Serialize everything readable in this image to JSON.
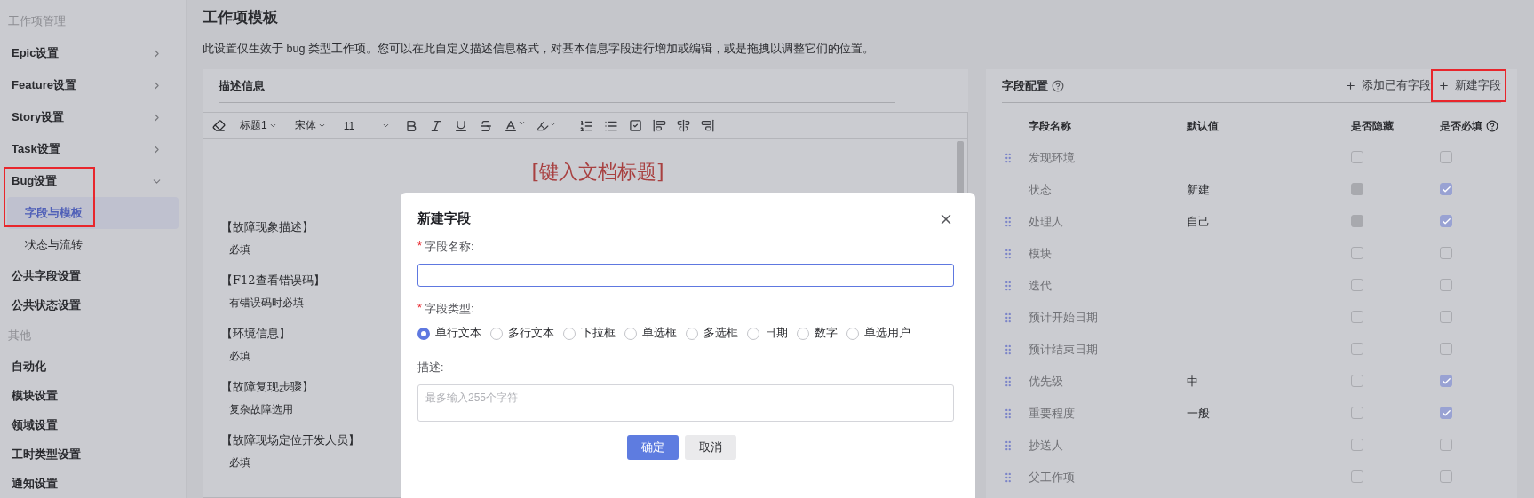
{
  "sidebar": {
    "items": [
      {
        "kind": "heading",
        "label": "工作项管理"
      },
      {
        "kind": "group",
        "label": "Epic设置",
        "expanded": false,
        "highlighted": false
      },
      {
        "kind": "group",
        "label": "Feature设置",
        "expanded": false,
        "highlighted": false
      },
      {
        "kind": "group",
        "label": "Story设置",
        "expanded": false,
        "highlighted": false
      },
      {
        "kind": "group",
        "label": "Task设置",
        "expanded": false,
        "highlighted": false
      },
      {
        "kind": "group",
        "label": "Bug设置",
        "expanded": true,
        "highlighted": true,
        "children": [
          {
            "label": "字段与模板",
            "selected": true
          },
          {
            "label": "状态与流转",
            "selected": false
          }
        ]
      },
      {
        "kind": "item",
        "label": "公共字段设置"
      },
      {
        "kind": "item",
        "label": "公共状态设置"
      },
      {
        "kind": "heading",
        "label": "其他"
      },
      {
        "kind": "item",
        "label": "自动化"
      },
      {
        "kind": "item",
        "label": "模块设置"
      },
      {
        "kind": "item",
        "label": "领域设置"
      },
      {
        "kind": "item",
        "label": "工时类型设置"
      },
      {
        "kind": "item",
        "label": "通知设置"
      }
    ]
  },
  "page": {
    "title": "工作项模板",
    "description": "此设置仅生效于 bug 类型工作项。您可以在此自定义描述信息格式，对基本信息字段进行增加或编辑，或是拖拽以调整它们的位置。"
  },
  "editor": {
    "section_title": "描述信息",
    "toolbar": {
      "heading": "标题1",
      "font": "宋体",
      "size": "11"
    },
    "doc_title": "[键入文档标题]",
    "blocks": [
      {
        "heading": "【故障现象描述】",
        "note": "必填"
      },
      {
        "heading": "【F12查看错误码】",
        "note": "有错误码时必填"
      },
      {
        "heading": "【环境信息】",
        "note": "必填"
      },
      {
        "heading": "【故障复现步骤】",
        "note": "复杂故障选用"
      },
      {
        "heading": "【故障现场定位开发人员】",
        "note": "必填"
      }
    ]
  },
  "fields": {
    "title": "字段配置",
    "actions": [
      {
        "label": "添加已有字段",
        "highlighted": false
      },
      {
        "label": "新建字段",
        "highlighted": true
      }
    ],
    "columns": [
      "字段名称",
      "默认值",
      "是否隐藏",
      "是否必填"
    ],
    "rows": [
      {
        "name": "发现环境",
        "draggable": true,
        "hidden": {
          "checked": false,
          "disabled": false
        },
        "required": {
          "checked": false
        }
      },
      {
        "name": "状态",
        "default": "新建",
        "draggable": false,
        "hidden": {
          "checked": false,
          "disabled": true
        },
        "required": {
          "checked": true
        }
      },
      {
        "name": "处理人",
        "default": "自己",
        "draggable": true,
        "hidden": {
          "checked": false,
          "disabled": true
        },
        "required": {
          "checked": true
        }
      },
      {
        "name": "模块",
        "draggable": true,
        "hidden": {
          "checked": false,
          "disabled": false
        },
        "required": {
          "checked": false
        }
      },
      {
        "name": "迭代",
        "draggable": true,
        "hidden": {
          "checked": false,
          "disabled": false
        },
        "required": {
          "checked": false
        }
      },
      {
        "name": "预计开始日期",
        "draggable": true,
        "hidden": {
          "checked": false,
          "disabled": false
        },
        "required": {
          "checked": false
        }
      },
      {
        "name": "预计结束日期",
        "draggable": true,
        "hidden": {
          "checked": false,
          "disabled": false
        },
        "required": {
          "checked": false
        }
      },
      {
        "name": "优先级",
        "default": "中",
        "draggable": true,
        "hidden": {
          "checked": false,
          "disabled": false
        },
        "required": {
          "checked": true
        }
      },
      {
        "name": "重要程度",
        "default": "一般",
        "draggable": true,
        "hidden": {
          "checked": false,
          "disabled": false
        },
        "required": {
          "checked": true
        }
      },
      {
        "name": "抄送人",
        "draggable": true,
        "hidden": {
          "checked": false,
          "disabled": false
        },
        "required": {
          "checked": false
        }
      },
      {
        "name": "父工作项",
        "draggable": true,
        "hidden": {
          "checked": false,
          "disabled": false
        },
        "required": {
          "checked": false
        }
      }
    ]
  },
  "dialog": {
    "title": "新建字段",
    "name_mark": "*",
    "name_label": "字段名称:",
    "type_mark": "*",
    "type_label": "字段类型:",
    "types": [
      {
        "label": "单行文本",
        "selected": true
      },
      {
        "label": "多行文本",
        "selected": false
      },
      {
        "label": "下拉框",
        "selected": false
      },
      {
        "label": "单选框",
        "selected": false
      },
      {
        "label": "多选框",
        "selected": false
      },
      {
        "label": "日期",
        "selected": false
      },
      {
        "label": "数字",
        "selected": false
      },
      {
        "label": "单选用户",
        "selected": false
      }
    ],
    "desc_label": "描述:",
    "desc_placeholder": "最多输入255个字符",
    "buttons": [
      {
        "label": "确定",
        "kind": "primary"
      },
      {
        "label": "取消",
        "kind": "secondary"
      }
    ]
  }
}
